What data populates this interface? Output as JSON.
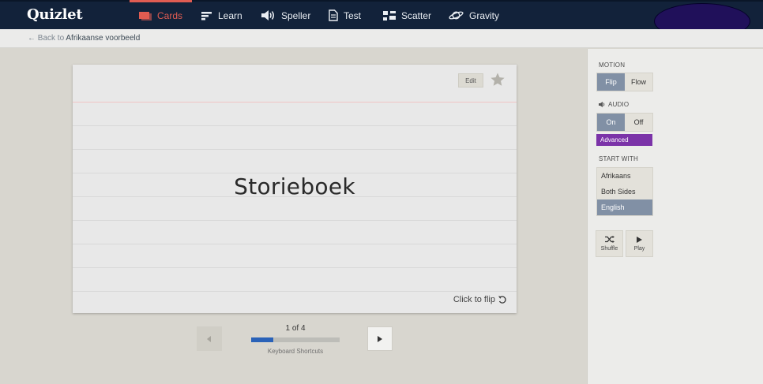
{
  "header": {
    "logo": "Quizlet",
    "nav": [
      {
        "label": "Cards",
        "icon": "cards-icon",
        "active": true
      },
      {
        "label": "Learn",
        "icon": "learn-icon",
        "active": false
      },
      {
        "label": "Speller",
        "icon": "speaker-icon",
        "active": false
      },
      {
        "label": "Test",
        "icon": "document-icon",
        "active": false
      },
      {
        "label": "Scatter",
        "icon": "scatter-icon",
        "active": false
      },
      {
        "label": "Gravity",
        "icon": "planet-icon",
        "active": false
      }
    ],
    "accent_color": "#e05c52",
    "bar_color": "#12223a"
  },
  "subbar": {
    "back_prefix": "← Back to",
    "set_name": "Afrikaanse voorbeeld"
  },
  "card": {
    "edit_label": "Edit",
    "term": "Storieboek",
    "flip_hint": "Click to flip"
  },
  "pager": {
    "counter": "1 of 4",
    "progress": 0.25,
    "shortcuts_label": "Keyboard Shortcuts"
  },
  "sidebar": {
    "motion_label": "MOTION",
    "motion_options": [
      "Flip",
      "Flow"
    ],
    "motion_selected": "Flip",
    "audio_label": "AUDIO",
    "audio_options": [
      "On",
      "Off"
    ],
    "audio_selected": "On",
    "advanced_label": "Advanced",
    "start_with_label": "START WITH",
    "start_options": [
      "Afrikaans",
      "Both Sides",
      "English"
    ],
    "start_selected": "English",
    "shuffle_label": "Shuffle",
    "play_label": "Play",
    "selected_color": "#8190a5",
    "advanced_color": "#7b33a8"
  }
}
